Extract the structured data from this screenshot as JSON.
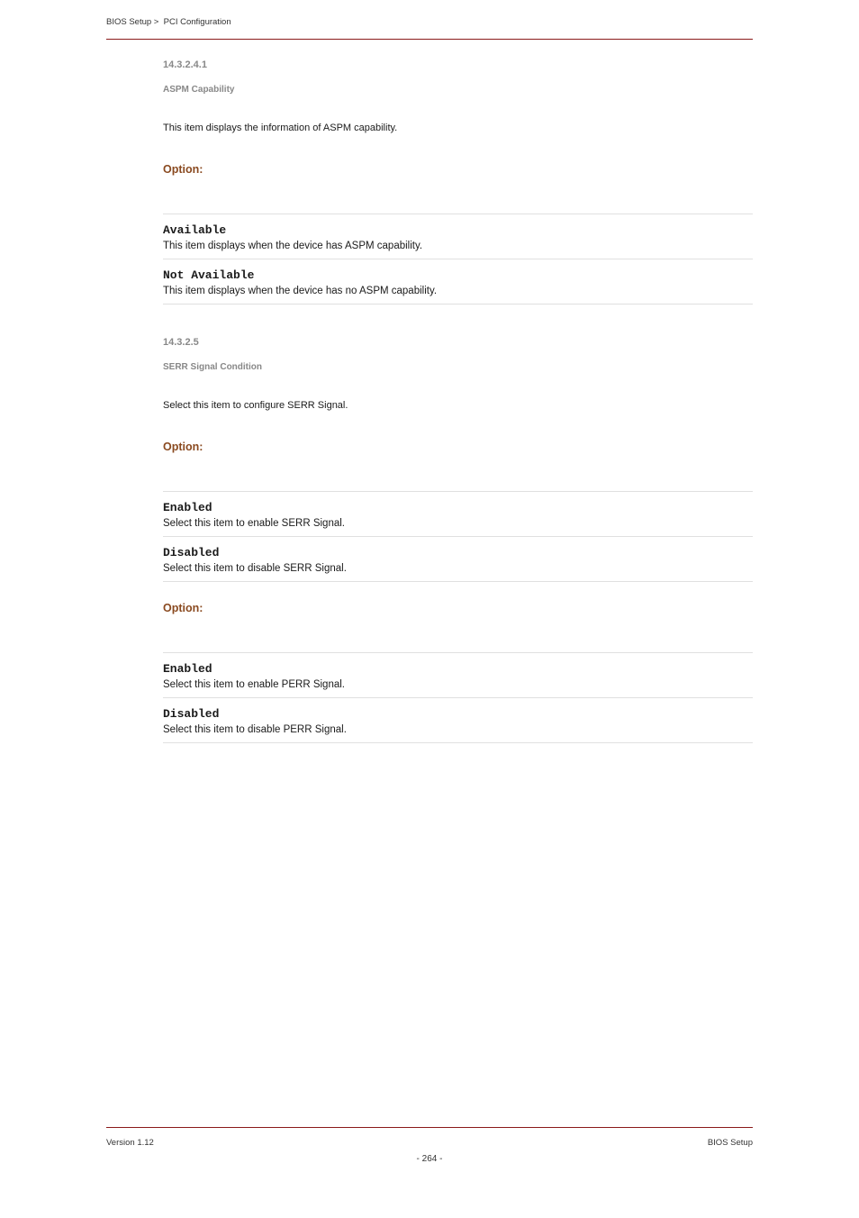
{
  "header": {
    "breadcrumb": "BIOS Setup >  PCI Configuration"
  },
  "sections": {
    "aspm_capability": {
      "heading_top": "14.3.2.4.1",
      "heading_sub": "ASPM Capability",
      "intro": "This item displays the information of ASPM capability.",
      "rows": [
        {
          "term": "Available",
          "def": "This item displays when the device has ASPM capability."
        },
        {
          "term": "Not Available",
          "def": "This item displays when the device has no ASPM capability."
        }
      ]
    },
    "serr": {
      "heading_top": "14.3.2.5",
      "heading_sub": "SERR Signal Condition",
      "intro": "Select this item to configure SERR Signal.",
      "option_h": "Option:",
      "rows": [
        {
          "term": "Enabled",
          "def": "Select this item to enable SERR Signal."
        },
        {
          "term": "Disabled",
          "def": "Select this item to disable SERR Signal."
        }
      ]
    },
    "perr": {
      "option_h": "Option:",
      "rows": [
        {
          "term": "Enabled",
          "def": "Select this item to enable PERR Signal."
        },
        {
          "term": "Disabled",
          "def": "Select this item to disable PERR Signal."
        }
      ]
    }
  },
  "footer": {
    "left": "Version 1.12",
    "center": "- 264 -",
    "right": "BIOS Setup"
  }
}
